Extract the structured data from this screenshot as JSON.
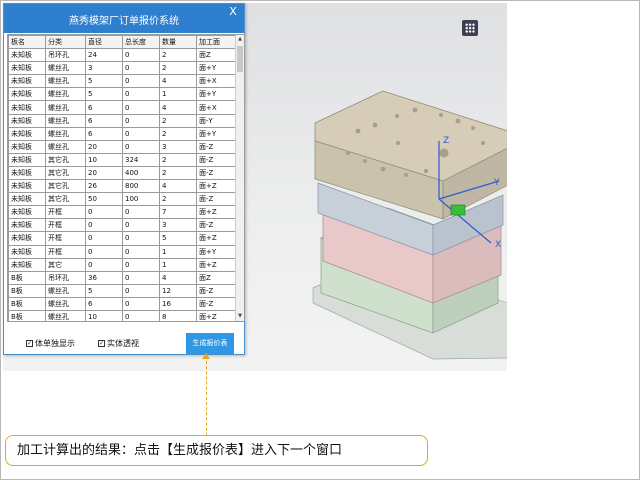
{
  "dialog": {
    "title": "燕秀模架厂订单报价系统",
    "close_label": "X",
    "columns": [
      "板名",
      "分类",
      "直径",
      "总长度",
      "数量",
      "加工面"
    ],
    "rows": [
      [
        "未知板",
        "吊环孔",
        "24",
        "0",
        "2",
        "面Z"
      ],
      [
        "未知板",
        "螺丝孔",
        "3",
        "0",
        "2",
        "面+Y"
      ],
      [
        "未知板",
        "螺丝孔",
        "5",
        "0",
        "4",
        "面+X"
      ],
      [
        "未知板",
        "螺丝孔",
        "5",
        "0",
        "1",
        "面+Y"
      ],
      [
        "未知板",
        "螺丝孔",
        "6",
        "0",
        "4",
        "面+X"
      ],
      [
        "未知板",
        "螺丝孔",
        "6",
        "0",
        "2",
        "面-Y"
      ],
      [
        "未知板",
        "螺丝孔",
        "6",
        "0",
        "2",
        "面+Y"
      ],
      [
        "未知板",
        "螺丝孔",
        "20",
        "0",
        "3",
        "面-Z"
      ],
      [
        "未知板",
        "其它孔",
        "10",
        "324",
        "2",
        "面-Z"
      ],
      [
        "未知板",
        "其它孔",
        "20",
        "400",
        "2",
        "面-Z"
      ],
      [
        "未知板",
        "其它孔",
        "26",
        "800",
        "4",
        "面+Z"
      ],
      [
        "未知板",
        "其它孔",
        "50",
        "100",
        "2",
        "面-Z"
      ],
      [
        "未知板",
        "开框",
        "0",
        "0",
        "7",
        "面+Z"
      ],
      [
        "未知板",
        "开框",
        "0",
        "0",
        "3",
        "面-Z"
      ],
      [
        "未知板",
        "开框",
        "0",
        "0",
        "5",
        "面+Z"
      ],
      [
        "未知板",
        "开框",
        "0",
        "0",
        "1",
        "面+Y"
      ],
      [
        "未知板",
        "其它",
        "0",
        "0",
        "1",
        "面+Z"
      ],
      [
        "B板",
        "吊环孔",
        "36",
        "0",
        "4",
        "面Z"
      ],
      [
        "B板",
        "螺丝孔",
        "5",
        "0",
        "12",
        "面-Z"
      ],
      [
        "B板",
        "螺丝孔",
        "6",
        "0",
        "16",
        "面-Z"
      ],
      [
        "B板",
        "螺丝孔",
        "10",
        "0",
        "8",
        "面+Z"
      ]
    ],
    "checkbox_show_single": "体单独显示",
    "checkbox_solid_transparent": "实体透视",
    "generate_button": "生成报价表"
  },
  "viewport": {
    "axis_x": "X",
    "axis_y": "Y",
    "axis_z": "Z"
  },
  "icons": {
    "view_menu": "grid-icon",
    "checkbox": "checkbox-checked-icon",
    "close": "close-icon"
  },
  "callout": {
    "text": "加工计算出的结果：点击【生成报价表】进入下一个窗口"
  },
  "colors": {
    "title_bar": "#2e7fcf",
    "button": "#2f98e4",
    "callout_border": "#e8a716"
  }
}
